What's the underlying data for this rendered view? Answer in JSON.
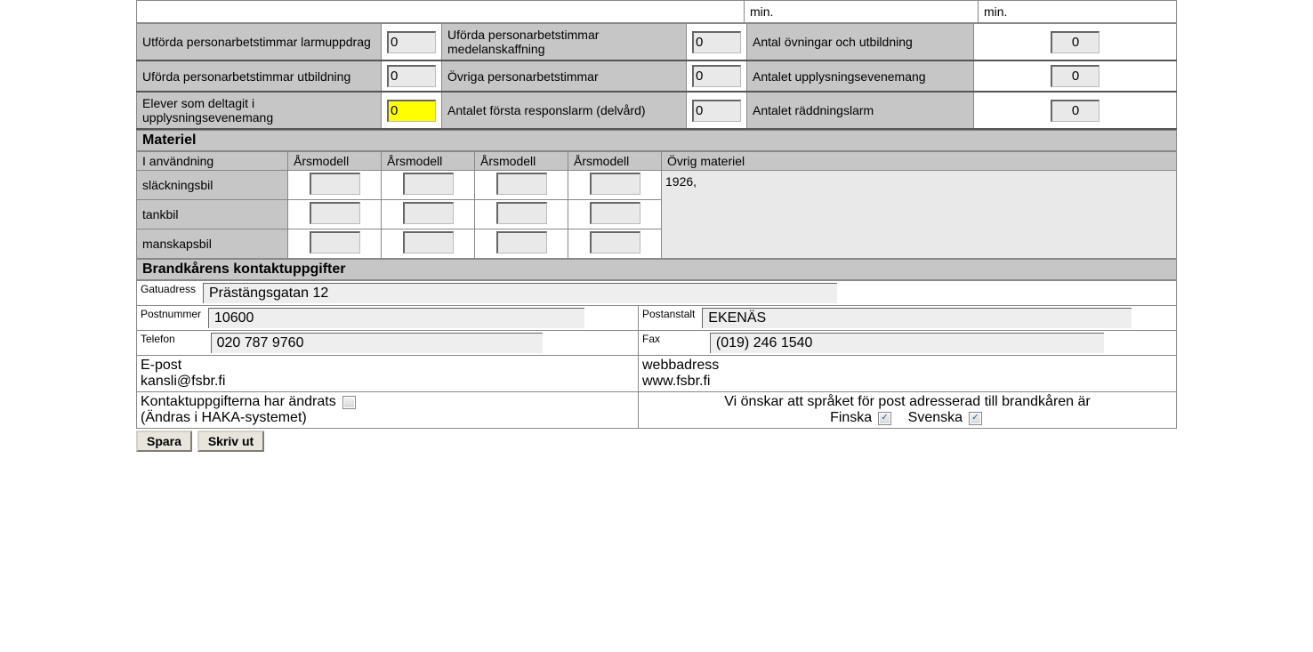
{
  "topmin": {
    "a": "min.",
    "b": "min."
  },
  "stats": {
    "r1": {
      "l1": "Utförda personarbetstimmar larmuppdrag",
      "v1": "0",
      "l2": "Uförda personarbetstimmar medelanskaffning",
      "v2": "0",
      "l3": "Antal övningar och utbildning",
      "v3": "0"
    },
    "r2": {
      "l1": "Uförda personarbetstimmar utbildning",
      "v1": "0",
      "l2": "Övriga personarbetstimmar",
      "v2": "0",
      "l3": "Antalet upplysningsevenemang",
      "v3": "0"
    },
    "r3": {
      "l1": "Elever som deltagit i upplysningsevenemang",
      "v1": "0",
      "l2": "Antalet första responslarm (delvård)",
      "v2": "0",
      "l3": "Antalet räddningslarm",
      "v3": "0"
    }
  },
  "materiel": {
    "title": "Materiel",
    "h": {
      "c0": "I användning",
      "c1": "Årsmodell",
      "c2": "Årsmodell",
      "c3": "Årsmodell",
      "c4": "Årsmodell",
      "c5": "Övrig materiel"
    },
    "rows": {
      "r0": "släckningsbil",
      "r1": "tankbil",
      "r2": "manskapsbil"
    },
    "ovrig": "1926,"
  },
  "contact": {
    "title": "Brandkårens kontaktuppgifter",
    "gatu_l": "Gatuadress",
    "gatu_v": "Prästängsgatan 12",
    "postn_l": "Postnummer",
    "postn_v": "10600",
    "posta_l": "Postanstalt",
    "posta_v": "EKENÄS",
    "tel_l": "Telefon",
    "tel_v": "020 787 9760",
    "fax_l": "Fax",
    "fax_v": "(019) 246 1540",
    "epost_l": "E-post",
    "epost_v": "kansli@fsbr.fi",
    "web_l": "webbadress",
    "web_v": "www.fsbr.fi",
    "chg1": "Kontaktuppgifterna har ändrats",
    "chg2": "(Ändras i HAKA-systemet)",
    "lang": "Vi önskar att språket för post adresserad till brandkåren är",
    "fin": "Finska",
    "sve": "Svenska",
    "check": "✓"
  },
  "buttons": {
    "save": "Spara",
    "print": "Skriv ut"
  }
}
